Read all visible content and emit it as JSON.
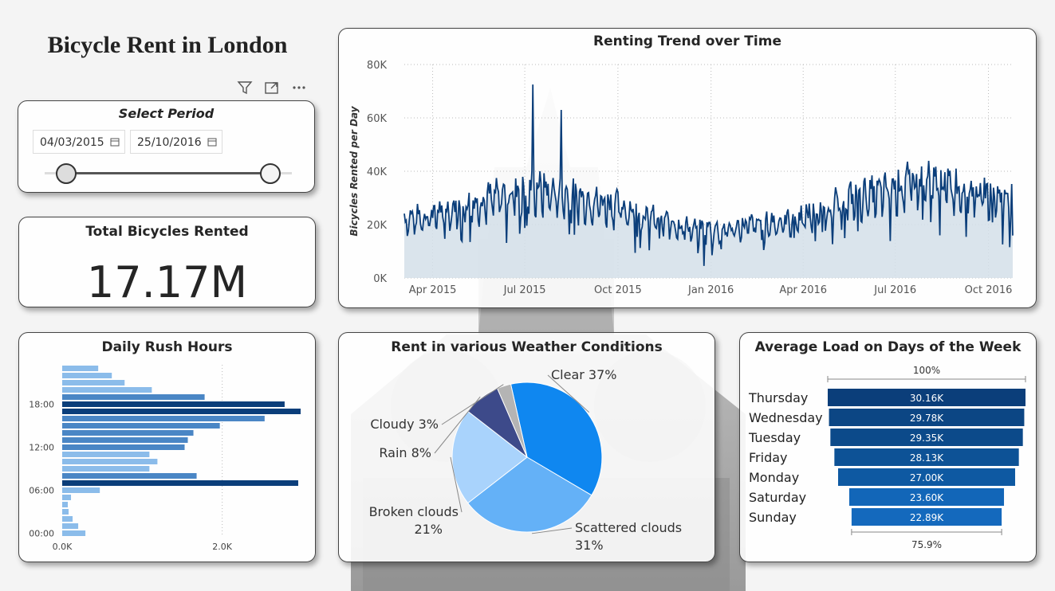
{
  "title": "Bicycle Rent in London",
  "visual_icons": [
    "filter-icon",
    "focus-mode-icon",
    "more-options-icon"
  ],
  "slicer": {
    "title": "Select Period",
    "start_date": "04/03/2015",
    "end_date": "25/10/2016"
  },
  "kpi": {
    "title": "Total Bicycles Rented",
    "value": "17.17M"
  },
  "colors": {
    "navy": "#0b3e7a",
    "mid": "#4a86c5",
    "light": "#8bbcea",
    "area": "#d4dfe9",
    "line": "#0b3e7a"
  },
  "chart_data": [
    {
      "id": "trend",
      "type": "area",
      "title": "Renting Trend over Time",
      "ylabel": "Bicycles Rented per Day",
      "ylim": [
        0,
        80000
      ],
      "y_ticks": [
        "0K",
        "20K",
        "40K",
        "60K",
        "80K"
      ],
      "x_ticks": [
        "Apr 2015",
        "Jul 2015",
        "Oct 2015",
        "Jan 2016",
        "Apr 2016",
        "Jul 2016",
        "Oct 2016"
      ],
      "x_range": [
        "2015-03-04",
        "2016-10-25"
      ],
      "monthly_baseline": [
        {
          "x": "2015-03",
          "y": 22000
        },
        {
          "x": "2015-04",
          "y": 25000
        },
        {
          "x": "2015-05",
          "y": 28000
        },
        {
          "x": "2015-06",
          "y": 31000
        },
        {
          "x": "2015-07",
          "y": 33000
        },
        {
          "x": "2015-08",
          "y": 30000
        },
        {
          "x": "2015-09",
          "y": 28000
        },
        {
          "x": "2015-10",
          "y": 25000
        },
        {
          "x": "2015-11",
          "y": 21000
        },
        {
          "x": "2015-12",
          "y": 18000
        },
        {
          "x": "2016-01",
          "y": 18000
        },
        {
          "x": "2016-02",
          "y": 20000
        },
        {
          "x": "2016-03",
          "y": 21000
        },
        {
          "x": "2016-04",
          "y": 24000
        },
        {
          "x": "2016-05",
          "y": 29000
        },
        {
          "x": "2016-06",
          "y": 31000
        },
        {
          "x": "2016-07",
          "y": 35000
        },
        {
          "x": "2016-08",
          "y": 35000
        },
        {
          "x": "2016-09",
          "y": 32000
        },
        {
          "x": "2016-10",
          "y": 30000
        }
      ],
      "peaks": [
        {
          "x": "2015-07-09",
          "y": 72500
        },
        {
          "x": "2015-08-06",
          "y": 63000
        },
        {
          "x": "2015-12-25",
          "y": 4500
        }
      ],
      "grid": true
    },
    {
      "id": "rush",
      "type": "bar",
      "title": "Daily Rush Hours",
      "orientation": "horizontal",
      "categories": [
        "00:00",
        "01:00",
        "02:00",
        "03:00",
        "04:00",
        "05:00",
        "06:00",
        "07:00",
        "08:00",
        "09:00",
        "10:00",
        "11:00",
        "12:00",
        "13:00",
        "14:00",
        "15:00",
        "16:00",
        "17:00",
        "18:00",
        "19:00",
        "20:00",
        "21:00",
        "22:00",
        "23:00"
      ],
      "y_tick_labels": [
        "00:00",
        "06:00",
        "12:00",
        "18:00"
      ],
      "values": [
        290,
        200,
        130,
        80,
        70,
        110,
        470,
        2950,
        1680,
        1090,
        1190,
        1090,
        1530,
        1570,
        1640,
        1970,
        2530,
        2980,
        2780,
        1780,
        1120,
        780,
        620,
        450
      ],
      "x_ticks": [
        "0.0K",
        "2.0K"
      ],
      "xlim": [
        0,
        3000
      ],
      "grid": true
    },
    {
      "id": "weather",
      "type": "pie",
      "title": "Rent in various Weather Conditions",
      "slices": [
        {
          "label": "Clear 37%",
          "value": 37,
          "color": "#0f87f0"
        },
        {
          "label": "Scattered clouds 31%",
          "value": 31,
          "color": "#64b1f7"
        },
        {
          "label": "Broken clouds 21%",
          "value": 21,
          "color": "#a9d3fc"
        },
        {
          "label": "Rain 8%",
          "value": 8,
          "color": "#3d4a8a"
        },
        {
          "label": "Cloudy 3%",
          "value": 3,
          "color": "#b4b4b4"
        }
      ]
    },
    {
      "id": "weekday",
      "type": "bar",
      "title": "Average Load on Days of the Week",
      "categories": [
        "Thursday",
        "Wednesday",
        "Tuesday",
        "Friday",
        "Monday",
        "Saturday",
        "Sunday"
      ],
      "values": [
        30160,
        29780,
        29350,
        28130,
        27000,
        23600,
        22890
      ],
      "value_labels": [
        "30.16K",
        "29.78K",
        "29.35K",
        "28.13K",
        "27.00K",
        "23.60K",
        "22.89K"
      ],
      "top_label": "100%",
      "bottom_label": "75.9%"
    }
  ]
}
